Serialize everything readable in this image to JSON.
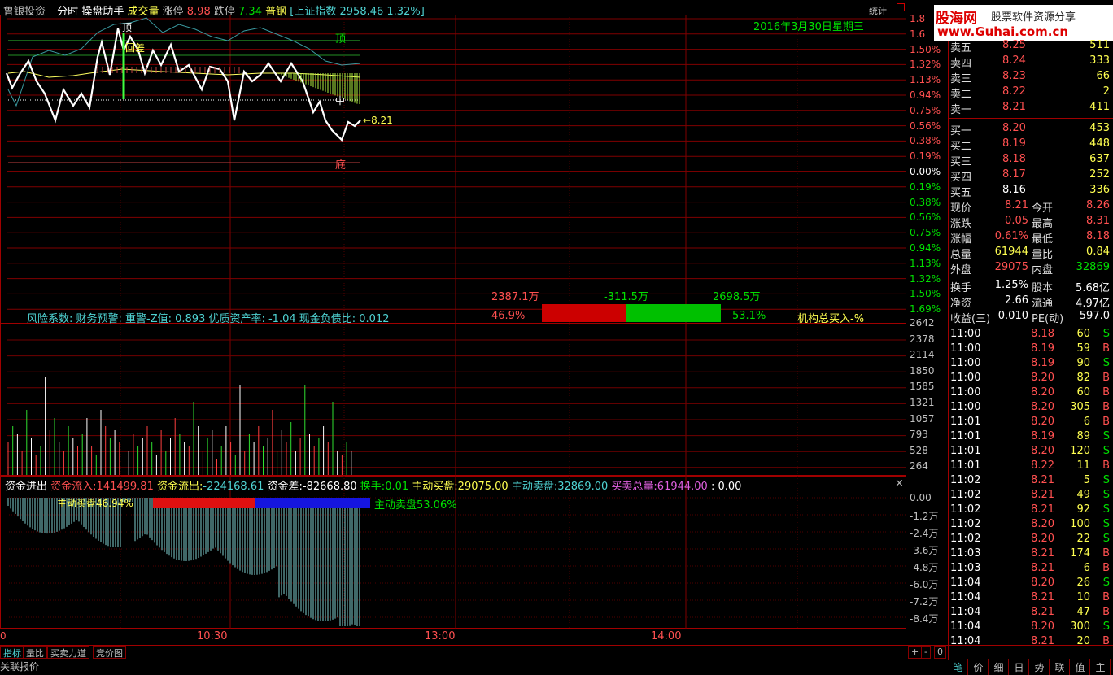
{
  "header": {
    "stock_name": "鲁银投资",
    "mode": "分时",
    "tool": "操盘助手",
    "volume_label": "成交量",
    "limit_up_label": "涨停",
    "limit_up": "8.98",
    "limit_down_label": "跌停",
    "limit_down": "7.34",
    "stock_type": "普钢",
    "index": "[上证指数",
    "index_value": "2958.46",
    "index_pct": "1.32%]",
    "stats_btn": "统计"
  },
  "logo": {
    "brand": "股海网",
    "slogan": "股票软件资源分享",
    "url": "www.Guhai.com.cn"
  },
  "price_chart": {
    "date": "2016年3月30日星期三",
    "top_label": "顶",
    "mid_label": "中",
    "bottom_label": "底",
    "pullback_label": "回差",
    "price_tag": "8.21",
    "price_axis": [
      "1.8",
      "1.6",
      "1.50%",
      "1.32%",
      "1.13%",
      "0.94%",
      "0.75%",
      "0.56%",
      "0.38%",
      "0.19%",
      "0.00%",
      "0.19%",
      "0.38%",
      "0.56%",
      "0.75%",
      "0.94%",
      "1.13%",
      "1.32%",
      "1.50%",
      "1.69%"
    ]
  },
  "risk": {
    "text": "风险系数: 财务预警: 重警-Z值: 0.893 优质资产率: -1.04 现金负债比: 0.012",
    "buy_amount": "2387.1万",
    "diff_amount": "-311.5万",
    "sell_amount": "2698.5万",
    "buy_pct": "46.9%",
    "sell_pct": "53.1%",
    "inst_label": "机构总买入-%",
    "buy_ratio": 0.469
  },
  "volume": {
    "axis": [
      "2642",
      "2378",
      "2114",
      "1850",
      "1585",
      "1321",
      "1057",
      "793",
      "528",
      "264"
    ]
  },
  "fund": {
    "title": "资金进出",
    "inflow_label": "资金流入:",
    "inflow": "141499.81",
    "outflow_label": "资金流出:",
    "outflow": "-224168.61",
    "diff_label": "资金差:",
    "diff": "-82668.80",
    "turnover_label": "换手:",
    "turnover": "0.01",
    "active_buy_label": "主动买盘:",
    "active_buy": "29075.00",
    "active_sell_label": "主动卖盘:",
    "active_sell": "32869.00",
    "total_label": "买卖总量:",
    "total": "61944.00",
    "extra": ": 0.00",
    "buy_bar_label": "主动买盘46.94%",
    "sell_bar_label": "主动卖盘53.06%",
    "buy_ratio": 0.4694,
    "axis": [
      "0.00",
      "-1.2万",
      "-2.4万",
      "-3.6万",
      "-4.8万",
      "-6.0万",
      "-7.2万",
      "-8.4万"
    ]
  },
  "time_axis": {
    "t0": "0",
    "t1": "10:30",
    "t2": "13:00",
    "t3": "14:00"
  },
  "tabs": [
    "指标",
    "量比",
    "买卖力道",
    "竞价图"
  ],
  "footer": "关联报价",
  "order_book": {
    "asks": [
      {
        "label": "卖五",
        "price": "8.25",
        "vol": "511"
      },
      {
        "label": "卖四",
        "price": "8.24",
        "vol": "333"
      },
      {
        "label": "卖三",
        "price": "8.23",
        "vol": "66"
      },
      {
        "label": "卖二",
        "price": "8.22",
        "vol": "2"
      },
      {
        "label": "卖一",
        "price": "8.21",
        "vol": "411"
      }
    ],
    "bids": [
      {
        "label": "买一",
        "price": "8.20",
        "vol": "453"
      },
      {
        "label": "买二",
        "price": "8.19",
        "vol": "448"
      },
      {
        "label": "买三",
        "price": "8.18",
        "vol": "637"
      },
      {
        "label": "买四",
        "price": "8.17",
        "vol": "252"
      },
      {
        "label": "买五",
        "price": "8.16",
        "vol": "336"
      }
    ]
  },
  "quote": [
    {
      "l1": "现价",
      "v1": "8.21",
      "c1": "red",
      "l2": "今开",
      "v2": "8.26",
      "c2": "red"
    },
    {
      "l1": "涨跌",
      "v1": "0.05",
      "c1": "red",
      "l2": "最高",
      "v2": "8.31",
      "c2": "red"
    },
    {
      "l1": "涨幅",
      "v1": "0.61%",
      "c1": "red",
      "l2": "最低",
      "v2": "8.18",
      "c2": "red"
    },
    {
      "l1": "总量",
      "v1": "61944",
      "c1": "yel",
      "l2": "量比",
      "v2": "0.84",
      "c2": "yel"
    },
    {
      "l1": "外盘",
      "v1": "29075",
      "c1": "red",
      "l2": "内盘",
      "v2": "32869",
      "c2": "grn"
    }
  ],
  "quote2": [
    {
      "l1": "换手",
      "v1": "1.25%",
      "l2": "股本",
      "v2": "5.68亿"
    },
    {
      "l1": "净资",
      "v1": "2.66",
      "l2": "流通",
      "v2": "4.97亿"
    },
    {
      "l1": "收益(三)",
      "v1": "0.010",
      "l2": "PE(动)",
      "v2": "597.0"
    }
  ],
  "trades": [
    {
      "t": "11:00",
      "p": "8.18",
      "v": "60",
      "d": "S"
    },
    {
      "t": "11:00",
      "p": "8.19",
      "v": "59",
      "d": "B"
    },
    {
      "t": "11:00",
      "p": "8.19",
      "v": "90",
      "d": "S"
    },
    {
      "t": "11:00",
      "p": "8.20",
      "v": "82",
      "d": "B"
    },
    {
      "t": "11:00",
      "p": "8.20",
      "v": "60",
      "d": "B"
    },
    {
      "t": "11:00",
      "p": "8.20",
      "v": "305",
      "d": "B"
    },
    {
      "t": "11:01",
      "p": "8.20",
      "v": "6",
      "d": "B"
    },
    {
      "t": "11:01",
      "p": "8.19",
      "v": "89",
      "d": "S"
    },
    {
      "t": "11:01",
      "p": "8.20",
      "v": "120",
      "d": "S"
    },
    {
      "t": "11:01",
      "p": "8.22",
      "v": "11",
      "d": "B"
    },
    {
      "t": "11:02",
      "p": "8.21",
      "v": "5",
      "d": "S"
    },
    {
      "t": "11:02",
      "p": "8.21",
      "v": "49",
      "d": "S"
    },
    {
      "t": "11:02",
      "p": "8.21",
      "v": "92",
      "d": "S"
    },
    {
      "t": "11:02",
      "p": "8.20",
      "v": "100",
      "d": "S"
    },
    {
      "t": "11:02",
      "p": "8.20",
      "v": "22",
      "d": "S"
    },
    {
      "t": "11:03",
      "p": "8.21",
      "v": "174",
      "d": "B"
    },
    {
      "t": "11:03",
      "p": "8.21",
      "v": "6",
      "d": "B"
    },
    {
      "t": "11:04",
      "p": "8.20",
      "v": "26",
      "d": "S"
    },
    {
      "t": "11:04",
      "p": "8.21",
      "v": "10",
      "d": "B"
    },
    {
      "t": "11:04",
      "p": "8.21",
      "v": "47",
      "d": "B"
    },
    {
      "t": "11:04",
      "p": "8.20",
      "v": "300",
      "d": "S"
    },
    {
      "t": "11:04",
      "p": "8.21",
      "v": "20",
      "d": "B"
    }
  ],
  "side_tabs": [
    "笔",
    "价",
    "细",
    "日",
    "势",
    "联",
    "值",
    "主"
  ],
  "controls": {
    "plus": "+",
    "minus": "-",
    "zero": "0",
    "close": "×"
  }
}
